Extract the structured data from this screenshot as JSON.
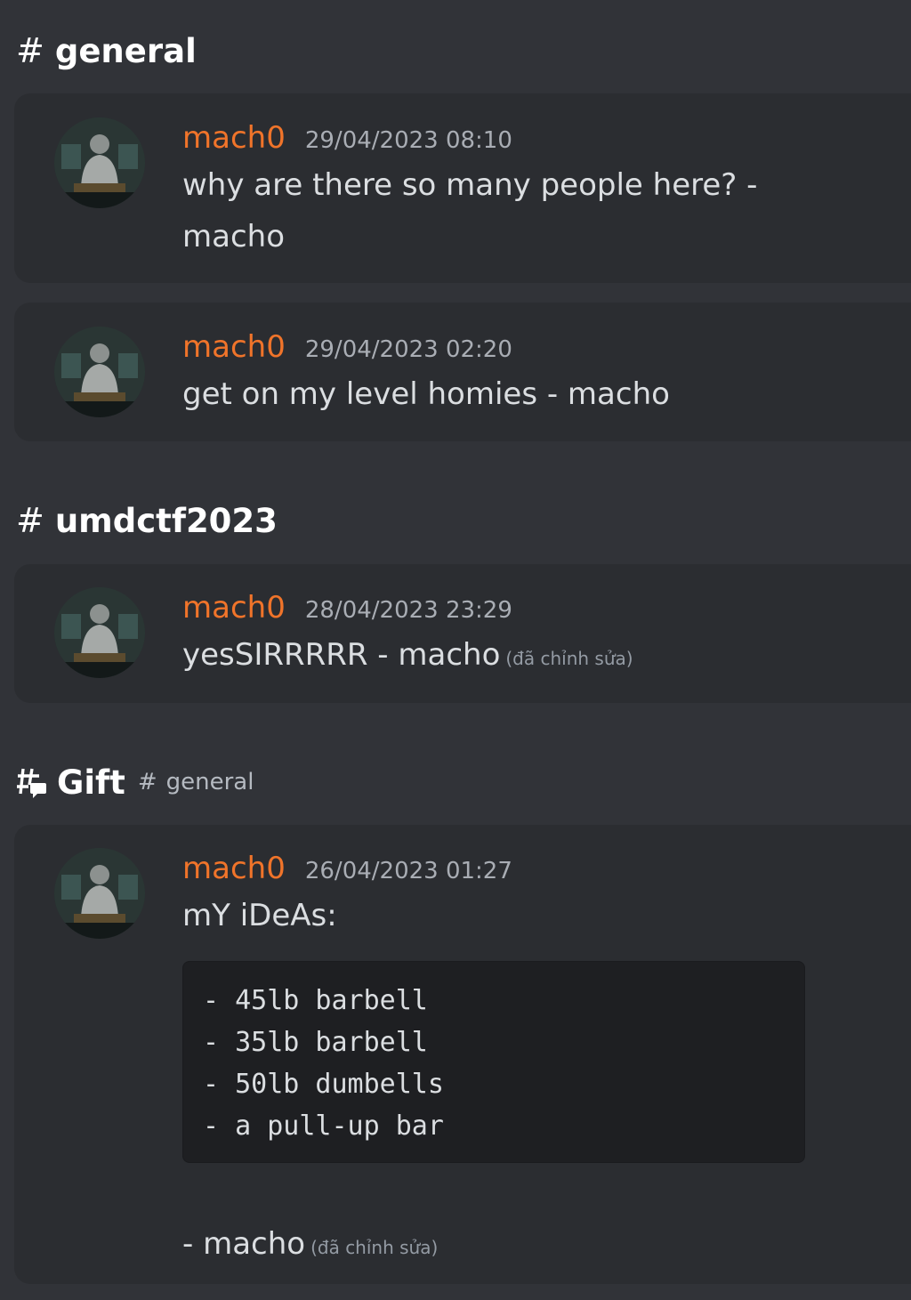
{
  "sections": [
    {
      "channel": "general",
      "messages": [
        {
          "author": "mach0",
          "timestamp": "29/04/2023 08:10",
          "lines": [
            "why are there so many people here? -",
            "macho"
          ]
        },
        {
          "author": "mach0",
          "timestamp": "29/04/2023 02:20",
          "lines": [
            "get on my level homies - macho"
          ]
        }
      ]
    },
    {
      "channel": "umdctf2023",
      "messages": [
        {
          "author": "mach0",
          "timestamp": "28/04/2023 23:29",
          "text": "yesSIRRRRR - macho",
          "edited": "(đã chỉnh sửa)"
        }
      ]
    },
    {
      "thread": "Gift",
      "parent_channel": "general",
      "messages": [
        {
          "author": "mach0",
          "timestamp": "26/04/2023 01:27",
          "text": "mY iDeAs:",
          "code_lines": [
            "- 45lb barbell",
            "- 35lb barbell",
            "- 50lb dumbells",
            "- a pull-up bar"
          ],
          "footer": "- macho",
          "edited": "(đã chỉnh sửa)"
        }
      ]
    }
  ],
  "icons": {
    "hash": "#",
    "thread": "thread-icon",
    "avatar": "avatar-image"
  },
  "colors": {
    "background": "#313338",
    "card": "#2b2d31",
    "username": "#f0742a",
    "code_background": "#1e1f22"
  }
}
